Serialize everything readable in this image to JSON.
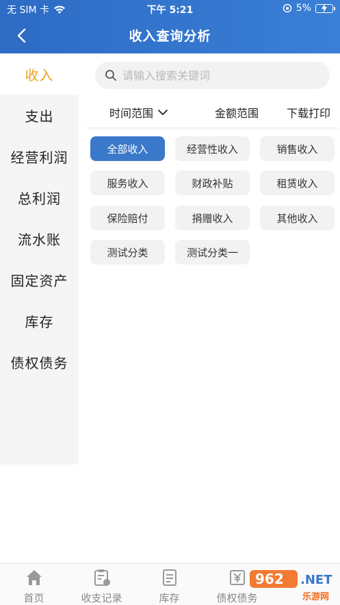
{
  "status_bar": {
    "carrier": "无 SIM 卡",
    "time": "下午 5:21",
    "battery": "5%"
  },
  "nav": {
    "title": "收入查询分析"
  },
  "sidebar": {
    "items": [
      {
        "label": "收入",
        "active": true
      },
      {
        "label": "支出"
      },
      {
        "label": "经营利润"
      },
      {
        "label": "总利润"
      },
      {
        "label": "流水账"
      },
      {
        "label": "固定资产"
      },
      {
        "label": "库存"
      },
      {
        "label": "债权债务"
      }
    ]
  },
  "search": {
    "placeholder": "请输入搜索关键词"
  },
  "filters": {
    "time_range": "时间范围",
    "amount_range": "金额范围",
    "download_print": "下载打印"
  },
  "categories": [
    {
      "label": "全部收入",
      "active": true
    },
    {
      "label": "经营性收入"
    },
    {
      "label": "销售收入"
    },
    {
      "label": "服务收入"
    },
    {
      "label": "财政补贴"
    },
    {
      "label": "租赁收入"
    },
    {
      "label": "保险赔付"
    },
    {
      "label": "捐赠收入"
    },
    {
      "label": "其他收入"
    },
    {
      "label": "测试分类"
    },
    {
      "label": "测试分类一"
    }
  ],
  "tabbar": {
    "items": [
      {
        "label": "首页",
        "icon": "home-icon"
      },
      {
        "label": "收支记录",
        "icon": "record-icon"
      },
      {
        "label": "库存",
        "icon": "inventory-icon"
      },
      {
        "label": "债权债务",
        "icon": "debt-icon"
      }
    ]
  },
  "watermark": {
    "text": "乐游网"
  },
  "colors": {
    "header_blue": "#2d6bc4",
    "active_tag": "#3a78c9",
    "sidebar_active": "#f0a020"
  }
}
